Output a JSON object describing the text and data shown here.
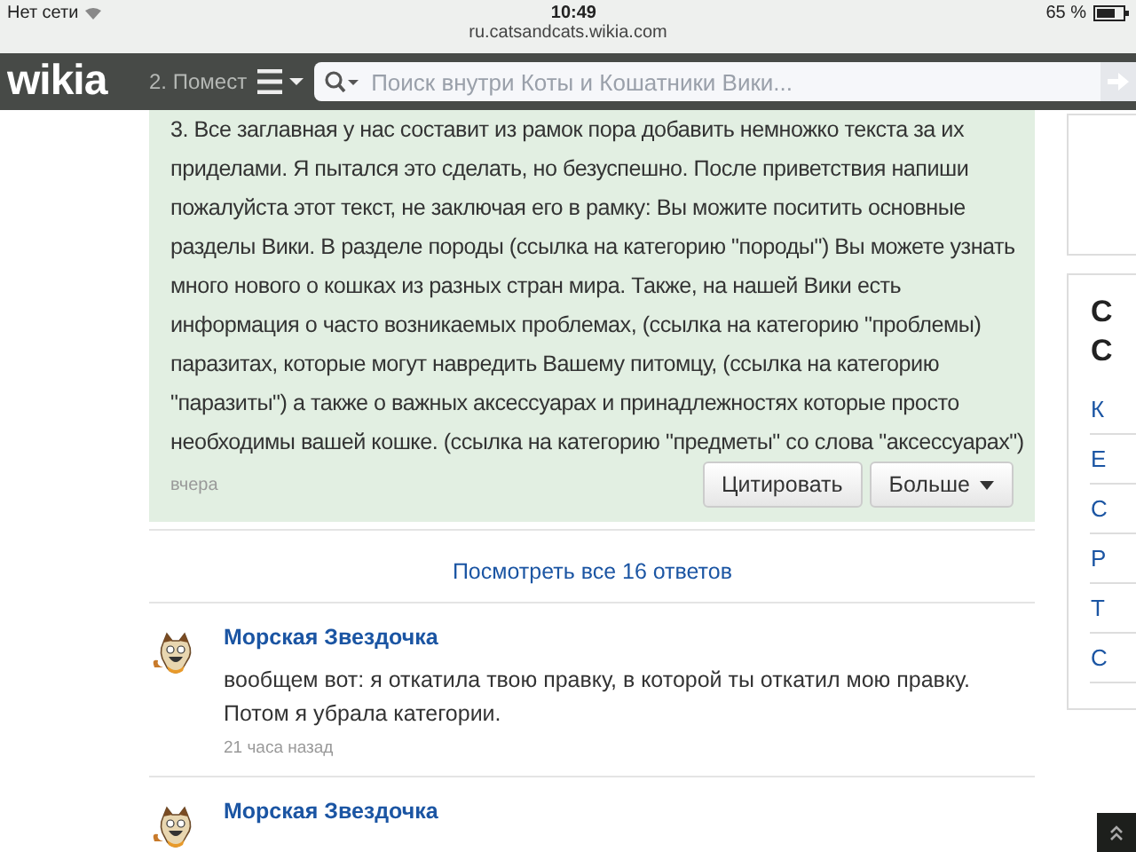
{
  "status_bar": {
    "carrier": "Нет сети",
    "time": "10:49",
    "battery": "65 %",
    "url": "ru.catsandcats.wikia.com"
  },
  "header": {
    "logo": "wikia",
    "behind_text": "2. Помест",
    "search": {
      "placeholder": "Поиск внутри Коты и Кошатники Вики..."
    }
  },
  "post": {
    "text": "3. Все заглавная у нас составит из рамок пора добавить немножко текста за их приделами. Я пытался это сделать, но безуспешно. После приветствия напиши пожалуйста этот текст, не заключая его в рамку: Вы можите поситить основные разделы Вики. В разделе породы (ссылка на категорию \"породы\") Вы можете узнать много нового о кошках из разных стран мира. Также, на нашей Вики есть информация о часто возникаемых проблемах, (ссылка на категорию \"проблемы) паразитах, которые могут навредить Вашему питомцу, (ссылка на категорию \"паразиты\") а также о важных аксессуарах и принадлежностях которые просто необходимы вашей кошке. (ссылка на категорию \"предметы\" со слова \"аксессуарах\")",
    "time": "вчера",
    "buttons": [
      {
        "label": "Цитировать",
        "kind": "plain"
      },
      {
        "label": "Больше",
        "kind": "dropdown"
      }
    ]
  },
  "view_all": "Посмотреть все 16 ответов",
  "replies": [
    {
      "author": "Морская Звездочка",
      "text": "вообщем вот: я откатила твою правку, в которой ты откатил мою правку. Потом я убрала категории.",
      "time": "21 часа назад"
    },
    {
      "author": "Морская Звездочка"
    }
  ],
  "sidebar": {
    "heading": [
      "С",
      "С"
    ],
    "links": [
      "К",
      "Е",
      "С",
      "Р",
      "Т",
      "С"
    ]
  }
}
